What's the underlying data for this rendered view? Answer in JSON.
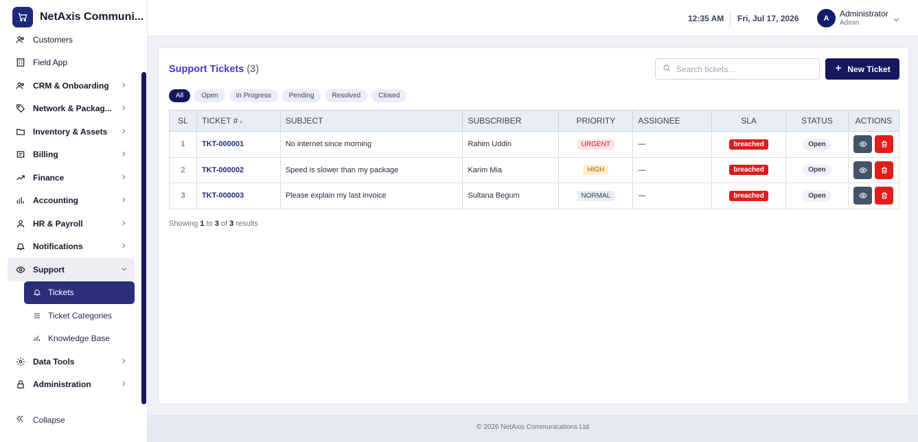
{
  "brand": {
    "name": "NetAxis Communi..."
  },
  "sidebar": {
    "items": [
      {
        "label": "Customers",
        "icon": "users-icon"
      },
      {
        "label": "Field App",
        "icon": "building-icon"
      },
      {
        "label": "CRM & Onboarding",
        "icon": "users-icon"
      },
      {
        "label": "Network & Packag...",
        "icon": "tag-icon"
      },
      {
        "label": "Inventory & Assets",
        "icon": "folder-icon"
      },
      {
        "label": "Billing",
        "icon": "receipt-icon"
      },
      {
        "label": "Finance",
        "icon": "trend-icon"
      },
      {
        "label": "Accounting",
        "icon": "bar-chart-icon"
      },
      {
        "label": "HR & Payroll",
        "icon": "user-icon"
      },
      {
        "label": "Notifications",
        "icon": "bell-icon"
      },
      {
        "label": "Support",
        "icon": "eye-icon"
      }
    ],
    "support_sub": [
      {
        "label": "Tickets",
        "icon": "bell-icon"
      },
      {
        "label": "Ticket Categories",
        "icon": "list-icon"
      },
      {
        "label": "Knowledge Base",
        "icon": "bar-chart-icon"
      }
    ],
    "bottom_items": [
      {
        "label": "Data Tools",
        "icon": "gear-icon"
      },
      {
        "label": "Administration",
        "icon": "lock-icon"
      }
    ],
    "collapse_label": "Collapse"
  },
  "topbar": {
    "time": "12:35 AM",
    "date": "Fri, Jul 17, 2026",
    "avatar_letter": "A",
    "user_name": "Administrator",
    "user_role": "Admin"
  },
  "page": {
    "title": "Support Tickets",
    "count": "(3)",
    "search_placeholder": "Search tickets...",
    "new_button": "New Ticket",
    "filters": [
      "All",
      "Open",
      "In Progress",
      "Pending",
      "Resolved",
      "Closed"
    ],
    "columns": [
      "SL",
      "TICKET #",
      "SUBJECT",
      "SUBSCRIBER",
      "PRIORITY",
      "ASSIGNEE",
      "SLA",
      "STATUS",
      "ACTIONS"
    ],
    "rows": [
      {
        "sl": "1",
        "ticket": "TKT-000001",
        "subject": "No internet since morning",
        "subscriber": "Rahim Uddin",
        "priority": "URGENT",
        "assignee": "—",
        "sla": "breached",
        "status": "Open"
      },
      {
        "sl": "2",
        "ticket": "TKT-000002",
        "subject": "Speed is slower than my package",
        "subscriber": "Karim Mia",
        "priority": "HIGH",
        "assignee": "—",
        "sla": "breached",
        "status": "Open"
      },
      {
        "sl": "3",
        "ticket": "TKT-000003",
        "subject": "Please explain my last invoice",
        "subscriber": "Sultana Begum",
        "priority": "NORMAL",
        "assignee": "—",
        "sla": "breached",
        "status": "Open"
      }
    ],
    "showing": {
      "prefix": "Showing",
      "from": "1",
      "to_word": "to",
      "to": "3",
      "of_word": "of",
      "total": "3",
      "suffix": "results"
    }
  },
  "footer": {
    "text": "© 2026 NetAxis Communications Ltd"
  },
  "colors": {
    "primary": "#14185e",
    "accent": "#4338ca",
    "danger": "#dc1c1c"
  }
}
